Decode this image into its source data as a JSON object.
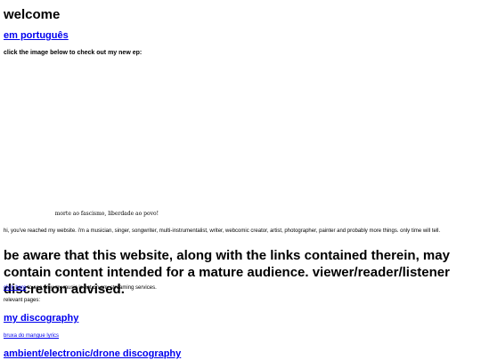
{
  "header": {
    "title": "welcome",
    "language_link": "em português"
  },
  "ep": {
    "prompt": "click the image below to check out my new ep:",
    "image_caption": "morte ao fascismo, liberdade ao povo!"
  },
  "intro_text": "hi, you've reached my website. i'm a musician, singer, songwriter, multi-instrumentalist, writer, webcomic creator, artist, photographer, painter and probably more things. only time will tell.",
  "warning_text": "be aware that this website, along with the links contained therein, may contain content intended for a mature audience. viewer/reader/listener discretion advised.",
  "streaming": {
    "link": "click here",
    "text": " to see why my music is not on any streaming services."
  },
  "relevant_pages": {
    "label": "relevant pages:",
    "links": [
      "my discography",
      "bruxa do mangue lyrics",
      "ambient/electronic/drone discography"
    ]
  },
  "colors": {
    "link": "#0000ee",
    "text": "#000000",
    "background": "#ffffff"
  }
}
